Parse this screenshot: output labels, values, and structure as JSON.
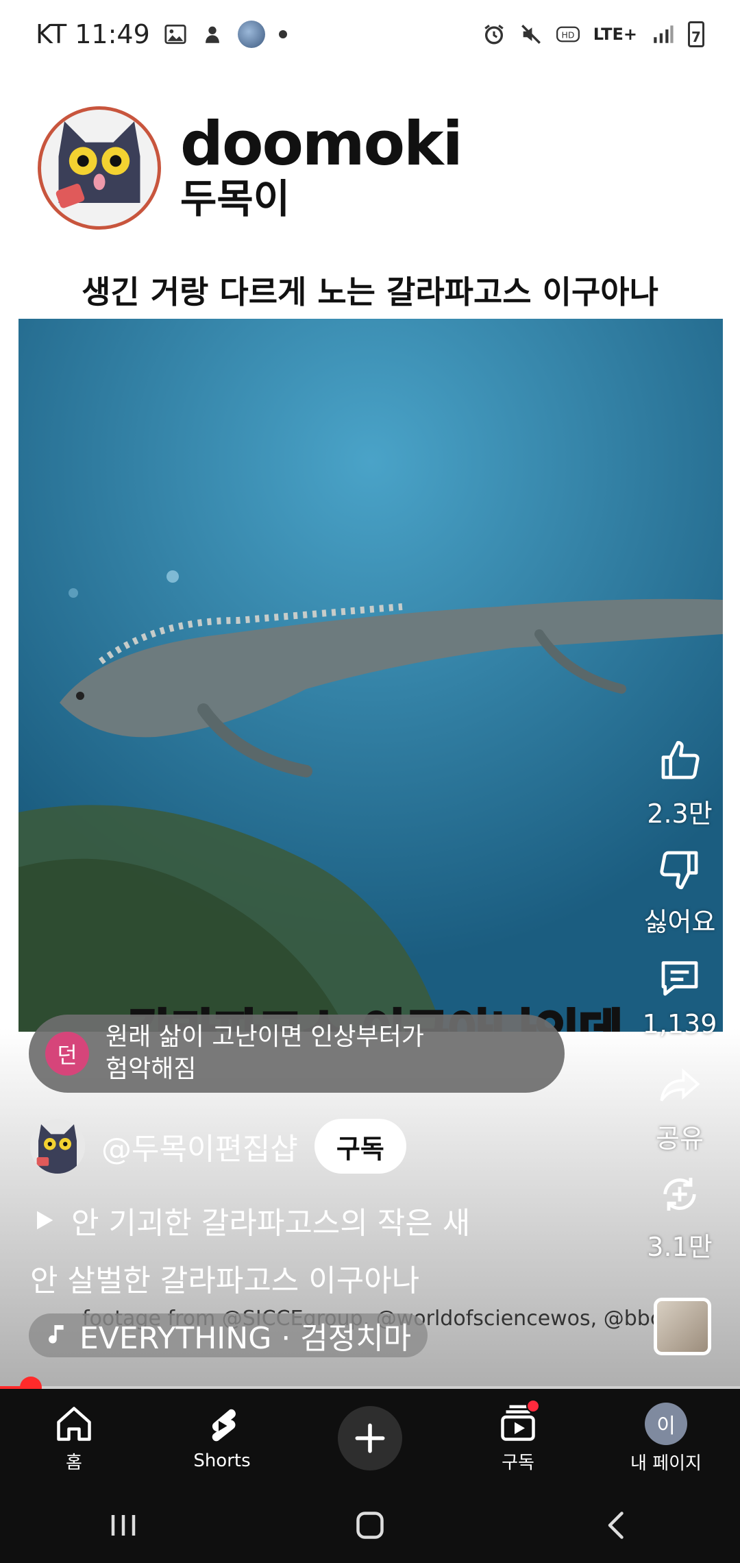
{
  "status_bar": {
    "carrier_time": "KT 11:49",
    "network": "LTE+",
    "battery": "7"
  },
  "channel_header": {
    "name": "doomoki",
    "subname": "두목이"
  },
  "video": {
    "top_caption": "생긴 거랑 다르게 노는 갈라파고스 이구아나",
    "subtitle": "갈라파고스 이구아나인데"
  },
  "comment_preview": {
    "avatar_letter": "던",
    "text_line1": "원래 삶이 고난이면 인상부터가",
    "text_line2": "험악해짐"
  },
  "actions": {
    "like_count": "2.3만",
    "dislike_label": "싫어요",
    "comment_count": "1,139",
    "share_label": "공유",
    "remix_count": "3.1만"
  },
  "channel_row": {
    "handle": "@두목이편집샵",
    "subscribe_label": "구독"
  },
  "related": {
    "text": "안 기괴한 갈라파고스의 작은 새"
  },
  "description": "안 살벌한 갈라파고스 이구아나",
  "footage_credit": "footage from @SICCEgroup, @worldofsciencewos, @bbcearth",
  "music": {
    "text": "EVERYTHING · 검정치마"
  },
  "progress": {
    "fraction": 0.042
  },
  "bottom_nav": {
    "home_label": "홈",
    "shorts_label": "Shorts",
    "subscriptions_label": "구독",
    "me_label": "내 페이지",
    "me_avatar_letter": "이"
  },
  "colors": {
    "accent_red": "#ff2a2a",
    "video_water": "#2a7aa4",
    "comment_avatar": "#d6457a"
  }
}
